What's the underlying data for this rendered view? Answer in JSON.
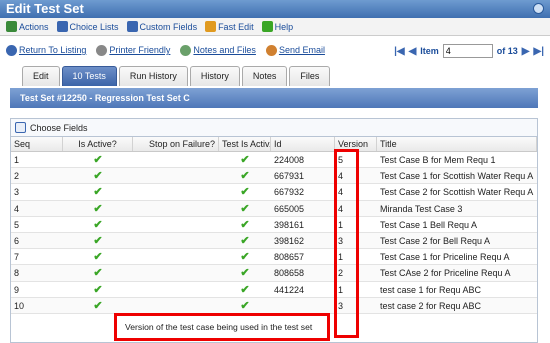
{
  "window": {
    "title": "Edit Test Set"
  },
  "menubar": {
    "items": [
      {
        "label": "Actions",
        "icon": "actions-icon",
        "color": "#3a8a3a"
      },
      {
        "label": "Choice Lists",
        "icon": "list-icon",
        "color": "#3a66b0"
      },
      {
        "label": "Custom Fields",
        "icon": "fields-icon",
        "color": "#3a66b0"
      },
      {
        "label": "Fast Edit",
        "icon": "pencil-icon",
        "color": "#e09a20"
      },
      {
        "label": "Help",
        "icon": "help-icon",
        "color": "#3aa626"
      }
    ]
  },
  "links": [
    {
      "label": "Return To Listing",
      "icon": "return-icon",
      "color": "#3a66b0"
    },
    {
      "label": "Printer Friendly",
      "icon": "printer-icon",
      "color": "#888"
    },
    {
      "label": "Notes and Files",
      "icon": "notes-icon",
      "color": "#6aa06a"
    },
    {
      "label": "Send Email",
      "icon": "email-icon",
      "color": "#d08030"
    }
  ],
  "pager": {
    "label": "Item",
    "value": "4",
    "total_label": "of 13"
  },
  "tabs": [
    "Edit",
    "10 Tests",
    "Run History",
    "History",
    "Notes",
    "Files"
  ],
  "active_tab": "10 Tests",
  "set_header": "Test Set #12250 - Regression Test Set C",
  "choose_fields": "Choose Fields",
  "columns": [
    "Seq",
    "Is Active?",
    "Stop on Failure?",
    "Test Is Activ...",
    "Id",
    "Version",
    "Title"
  ],
  "rows": [
    {
      "seq": "1",
      "id": "224008",
      "version": "5",
      "title": "Test Case B for Mem Requ 1"
    },
    {
      "seq": "2",
      "id": "667931",
      "version": "4",
      "title": "Test Case 1 for Scottish Water Requ A"
    },
    {
      "seq": "3",
      "id": "667932",
      "version": "4",
      "title": "Test Case 2 for Scottish Water Requ A"
    },
    {
      "seq": "4",
      "id": "665005",
      "version": "4",
      "title": "Miranda Test Case 3"
    },
    {
      "seq": "5",
      "id": "398161",
      "version": "1",
      "title": "Test Case 1 Bell Requ A"
    },
    {
      "seq": "6",
      "id": "398162",
      "version": "3",
      "title": "Test Case 2 for Bell Requ A"
    },
    {
      "seq": "7",
      "id": "808657",
      "version": "1",
      "title": "Test Case 1 for Priceline Requ A"
    },
    {
      "seq": "8",
      "id": "808658",
      "version": "2",
      "title": "Test CAse 2 for Priceline Requ A"
    },
    {
      "seq": "9",
      "id": "441224",
      "version": "1",
      "title": "test case 1 for Requ ABC"
    },
    {
      "seq": "10",
      "id": "",
      "version": "3",
      "title": "test case 2 for Requ ABC"
    }
  ],
  "callout": "Version of the test case being used in the test set",
  "accent_color": "#4e77b8",
  "highlight_color": "#e00000"
}
